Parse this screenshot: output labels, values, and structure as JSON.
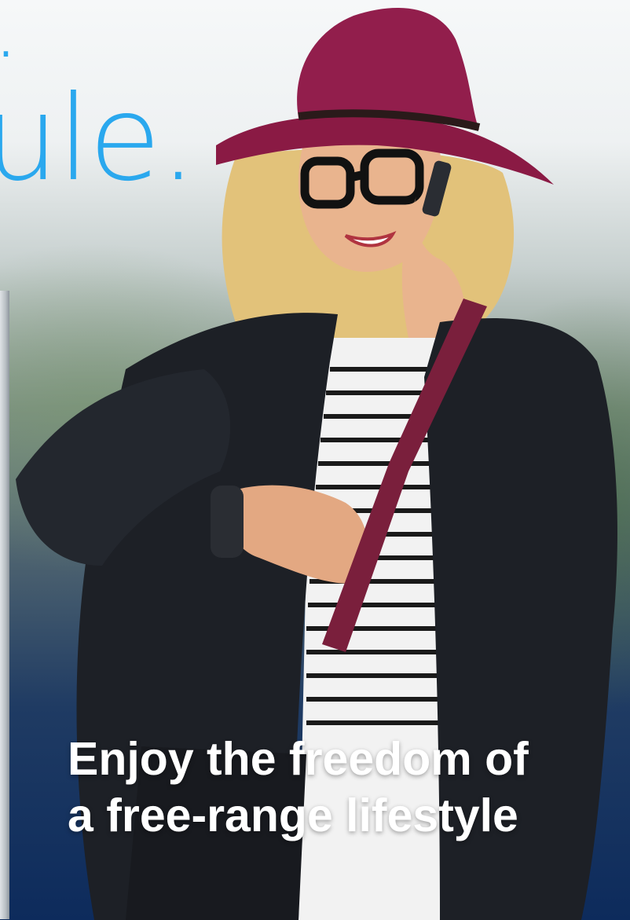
{
  "headline": {
    "fragment_line1": ".",
    "fragment_line2": "ule."
  },
  "caption": {
    "line1": "Enjoy the freedom of",
    "line2": "a free-range lifestyle"
  },
  "colors": {
    "headline_blue": "#2aa8ee",
    "caption_white": "#ffffff",
    "hat": "#8a1a44",
    "jacket": "#1d2026"
  },
  "photo": {
    "subject": "woman-on-phone-checking-smartwatch"
  }
}
